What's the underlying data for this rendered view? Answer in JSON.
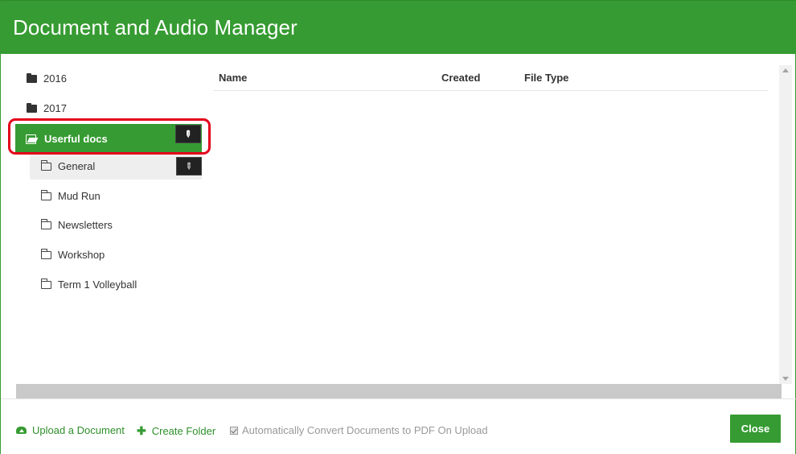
{
  "header": {
    "title": "Document and Audio Manager"
  },
  "tree": {
    "top_items": [
      {
        "label": "2016"
      },
      {
        "label": "2017"
      }
    ],
    "active_folder": {
      "label": "Userful docs"
    },
    "sub_items": [
      {
        "label": "General"
      },
      {
        "label": "Mud Run"
      },
      {
        "label": "Newsletters"
      },
      {
        "label": "Workshop"
      },
      {
        "label": "Term 1 Volleyball"
      }
    ]
  },
  "table": {
    "columns": [
      "Name",
      "Created",
      "File Type"
    ]
  },
  "footer": {
    "upload_label": "Upload a Document",
    "create_folder_label": "Create Folder",
    "auto_convert_label": "Automatically Convert Documents to PDF On Upload",
    "auto_convert_checked": true,
    "close_label": "Close"
  },
  "colors": {
    "accent": "#369b32",
    "highlight": "#e4001b"
  }
}
